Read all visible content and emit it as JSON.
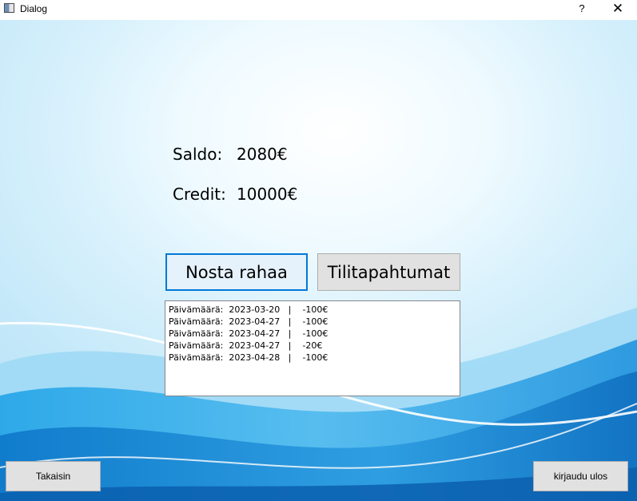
{
  "window": {
    "title": "Dialog",
    "help_glyph": "?",
    "close_glyph": "✕"
  },
  "account": {
    "saldo_label": "Saldo:",
    "saldo_value": "2080€",
    "credit_label": "Credit:",
    "credit_value": "10000€"
  },
  "actions": {
    "withdraw_label": "Nosta rahaa",
    "transactions_label": "Tilitapahtumat"
  },
  "transactions": [
    "Päivämäärä:  2023-03-20   |    -100€",
    "Päivämäärä:  2023-04-27   |    -100€",
    "Päivämäärä:  2023-04-27   |    -100€",
    "Päivämäärä:  2023-04-27   |    -20€",
    "Päivämäärä:  2023-04-28   |    -100€"
  ],
  "footer": {
    "back_label": "Takaisin",
    "logout_label": "kirjaudu ulos"
  },
  "colors": {
    "focus_border": "#0078d7",
    "button_bg": "#e1e1e1"
  }
}
